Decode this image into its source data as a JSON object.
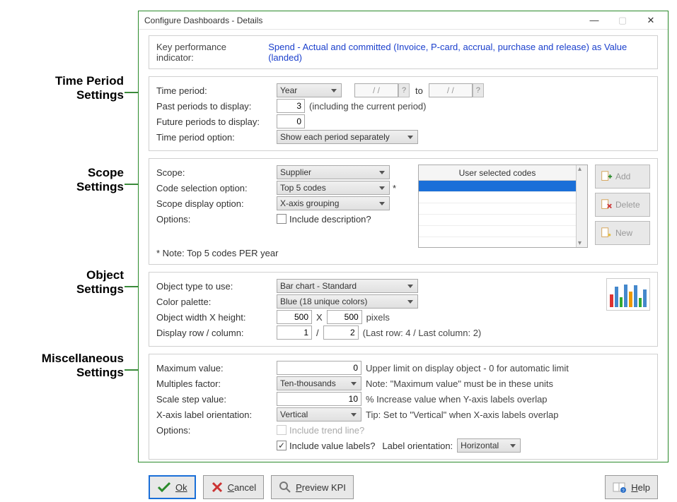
{
  "window": {
    "title": "Configure Dashboards - Details"
  },
  "annotations": {
    "time": "Time Period\nSettings",
    "scope": "Scope\nSettings",
    "object": "Object\nSettings",
    "misc": "Miscellaneous\nSettings"
  },
  "kpi": {
    "label": "Key performance indicator:",
    "value": "Spend - Actual and committed (Invoice, P-card, accrual, purchase and release) as Value (landed)"
  },
  "time": {
    "period_label": "Time period:",
    "period_value": "Year",
    "date1": "/  /",
    "to": "to",
    "date2": "/  /",
    "past_label": "Past periods to display:",
    "past_value": "3",
    "past_note": "(including the current period)",
    "future_label": "Future periods to display:",
    "future_value": "0",
    "option_label": "Time period option:",
    "option_value": "Show each period separately"
  },
  "scope": {
    "scope_label": "Scope:",
    "scope_value": "Supplier",
    "codesel_label": "Code selection option:",
    "codesel_value": "Top 5 codes",
    "star": "*",
    "display_label": "Scope display option:",
    "display_value": "X-axis grouping",
    "options_label": "Options:",
    "include_desc": "Include description?",
    "note": "* Note: Top 5 codes PER year",
    "codes_header": "User selected codes",
    "btn_add": "Add",
    "btn_delete": "Delete",
    "btn_new": "New"
  },
  "object": {
    "type_label": "Object type to use:",
    "type_value": "Bar chart - Standard",
    "palette_label": "Color palette:",
    "palette_value": "Blue (18 unique colors)",
    "wh_label": "Object width X height:",
    "width": "500",
    "x": "X",
    "height": "500",
    "pixels": "pixels",
    "rc_label": "Display row / column:",
    "row": "1",
    "slash": "/",
    "col": "2",
    "rc_note": "(Last row: 4 / Last column: 2)"
  },
  "misc": {
    "max_label": "Maximum value:",
    "max_value": "0",
    "max_note": "Upper limit on display object - 0 for automatic limit",
    "mult_label": "Multiples factor:",
    "mult_value": "Ten-thousands",
    "mult_note": "Note: \"Maximum value\" must be in these units",
    "scale_label": "Scale step value:",
    "scale_value": "10",
    "scale_note": "% Increase value when Y-axis labels overlap",
    "xaxis_label": "X-axis label orientation:",
    "xaxis_value": "Vertical",
    "xaxis_note": "Tip: Set to \"Vertical\" when X-axis labels overlap",
    "options_label": "Options:",
    "trend": "Include trend line?",
    "valuelbl": "Include value labels?",
    "lblorient_label": "Label orientation:",
    "lblorient_value": "Horizontal"
  },
  "buttons": {
    "ok": "Ok",
    "cancel": "Cancel",
    "preview": "Preview KPI",
    "help": "Help"
  }
}
